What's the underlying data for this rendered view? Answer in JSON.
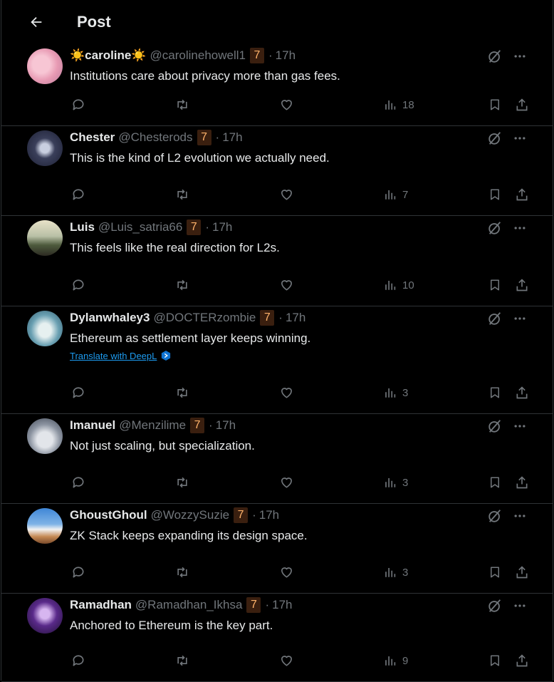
{
  "header": {
    "title": "Post"
  },
  "colors": {
    "accent": "#1d9bf0",
    "badge_bg": "#3a1f0f",
    "badge_fg": "#ffb36b",
    "muted": "#71767b",
    "text": "#e7e9ea"
  },
  "replies": [
    {
      "name": "☀️caroline☀️",
      "handle": "@carolinehowell1",
      "badge": "7",
      "time": "17h",
      "text": "Institutions care about privacy more than gas fees.",
      "views": "18",
      "translate": ""
    },
    {
      "name": "Chester",
      "handle": "@Chesterods",
      "badge": "7",
      "time": "17h",
      "text": "This is the kind of L2 evolution we actually need.",
      "views": "7",
      "translate": ""
    },
    {
      "name": "Luis",
      "handle": "@Luis_satria66",
      "badge": "7",
      "time": "17h",
      "text": "This feels like the real direction for L2s.",
      "views": "10",
      "translate": ""
    },
    {
      "name": "Dylanwhaley3",
      "handle": "@DOCTERzombie",
      "badge": "7",
      "time": "17h",
      "text": "Ethereum as settlement layer keeps winning.",
      "views": "3",
      "translate": "Translate with DeepL"
    },
    {
      "name": "Imanuel",
      "handle": "@Menzilime",
      "badge": "7",
      "time": "17h",
      "text": "Not just scaling, but specialization.",
      "views": "3",
      "translate": ""
    },
    {
      "name": "GhoustGhoul",
      "handle": "@WozzySuzie",
      "badge": "7",
      "time": "17h",
      "text": "ZK Stack keeps expanding its design space.",
      "views": "3",
      "translate": ""
    },
    {
      "name": "Ramadhan",
      "handle": "@Ramadhan_Ikhsa",
      "badge": "7",
      "time": "17h",
      "text": "Anchored to Ethereum is the key part.",
      "views": "9",
      "translate": ""
    }
  ],
  "icons": [
    "back-arrow-icon",
    "grok-icon",
    "more-icon",
    "reply-icon",
    "repost-icon",
    "like-icon",
    "views-icon",
    "bookmark-icon",
    "share-icon",
    "deepl-icon"
  ]
}
